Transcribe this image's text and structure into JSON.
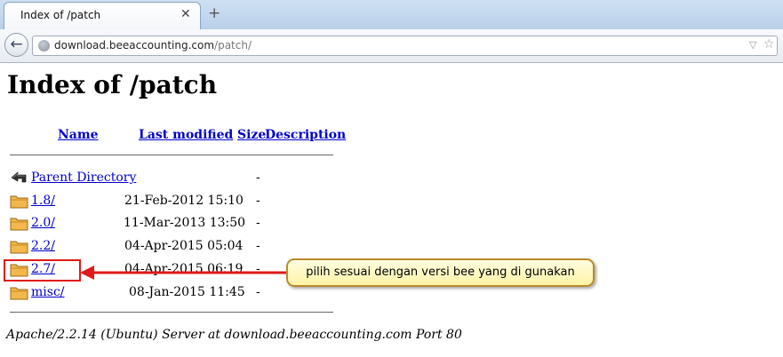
{
  "browser": {
    "tab_title": "Index of /patch",
    "tab_close": "✕",
    "new_tab": "+",
    "back": "←",
    "url_host": "download.beeaccounting.com",
    "url_path": "/patch/",
    "dropdown": "▽",
    "bookmark": "☆"
  },
  "page": {
    "title": "Index of /patch",
    "columns": [
      "Name",
      "Last modified",
      "Size",
      "Description"
    ],
    "rows": [
      {
        "icon": "back-arrow-icon",
        "name": "Parent Directory",
        "modified": "",
        "size": "-"
      },
      {
        "icon": "folder-icon",
        "name": "1.8/",
        "modified": "21-Feb-2012 15:10",
        "size": "-"
      },
      {
        "icon": "folder-icon",
        "name": "2.0/",
        "modified": "11-Mar-2013 13:50",
        "size": "-"
      },
      {
        "icon": "folder-icon",
        "name": "2.2/",
        "modified": "04-Apr-2015 05:04",
        "size": "-"
      },
      {
        "icon": "folder-icon",
        "name": "2.7/",
        "modified": "04-Apr-2015 06:19",
        "size": "-"
      },
      {
        "icon": "folder-icon",
        "name": "misc/",
        "modified": "08-Jan-2015 11:45",
        "size": "-"
      }
    ],
    "address": "Apache/2.2.14 (Ubuntu) Server at download.beeaccounting.com Port 80"
  },
  "annotation": {
    "callout_text": "pilih sesuai dengan versi bee yang di gunakan",
    "highlight_color": "#e01a1a",
    "callout_fill": "#fff6b5"
  }
}
